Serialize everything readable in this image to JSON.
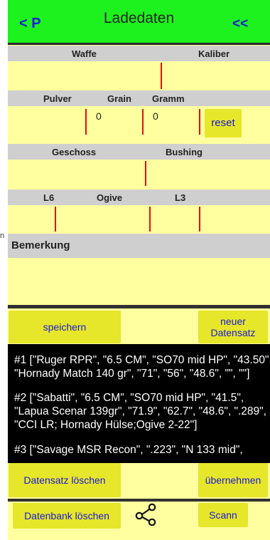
{
  "edge_fragment": "n",
  "header": {
    "left_button": "< P",
    "title": "Ladedaten",
    "right_button": "<<"
  },
  "labels": {
    "waffe": "Waffe",
    "kaliber": "Kaliber",
    "pulver": "Pulver",
    "grain": "Grain",
    "gramm": "Gramm",
    "geschoss": "Geschoss",
    "bushing": "Bushing",
    "l6": "L6",
    "ogive": "Ogive",
    "l3": "L3",
    "bemerkung": "Bemerkung"
  },
  "fields": {
    "grain_value": "0",
    "gramm_value": "0"
  },
  "buttons": {
    "reset": "reset",
    "speichern": "speichern",
    "neuer_line1": "neuer",
    "neuer_line2": "Datensatz",
    "datensatz_loeschen": "Datensatz löschen",
    "uebernehmen": "übernehmen",
    "datenbank_loeschen": "Datenbank löschen",
    "scann": "Scann"
  },
  "records": [
    {
      "line1": "#1   [\"Ruger RPR\", \"6.5 CM\", \"SO70 mid HP\", \"43.50\",",
      "line2": "\"Hornady Match 140 gr\", \"71\", \"56\", \"48.6\", \"\", \"\"]"
    },
    {
      "line1": "#2   [\"Sabatti\", \"6.5 CM\", \"SO70 mid HP\", \"41.5\",",
      "line2": "\"Lapua Scenar 139gr\", \"71.9\", \"62.7\", \"48.6\", \".289\",",
      "line3": "\"CCI LR; Hornady Hülse;Ogive 2-22\"]"
    },
    {
      "line1": "#3   [\"Savage MSR Recon\", \".223\", \"N 133 mid\","
    }
  ],
  "icons": {
    "share": "share-icon"
  },
  "colors": {
    "header_bg": "#1ef21e",
    "field_bg": "#ffffa0",
    "button_bg": "#e6e62a",
    "label_bar": "#cfcfcf",
    "link_blue": "#1a1ad6",
    "cursor_red": "#e01010"
  }
}
